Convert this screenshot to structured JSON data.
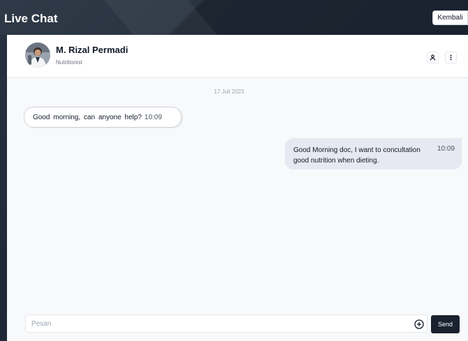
{
  "app": {
    "title": "Live Chat",
    "back_label": "Kembali"
  },
  "contact": {
    "name": "M. Rizal Permadi",
    "role": "Nutritionist",
    "avatar_icon": "person-photo",
    "profile_icon": "person-icon",
    "menu_icon": "more-vertical-icon"
  },
  "conversation": {
    "date": "17 Juli 2023",
    "messages": [
      {
        "direction": "incoming",
        "text": "Good morning, can anyone help?",
        "time": "10:09"
      },
      {
        "direction": "outgoing",
        "text": "Good Morning doc, I want to concultation good nutrition when dieting.",
        "time": "10:09"
      }
    ]
  },
  "composer": {
    "placeholder": "Pesan",
    "value": "",
    "attach_icon": "plus-circle-icon",
    "send_label": "Send"
  },
  "colors": {
    "header_dark": "#1a2230",
    "outgoing_bubble": "#e6e9f1",
    "panel_bg": "#f8f9fb"
  }
}
